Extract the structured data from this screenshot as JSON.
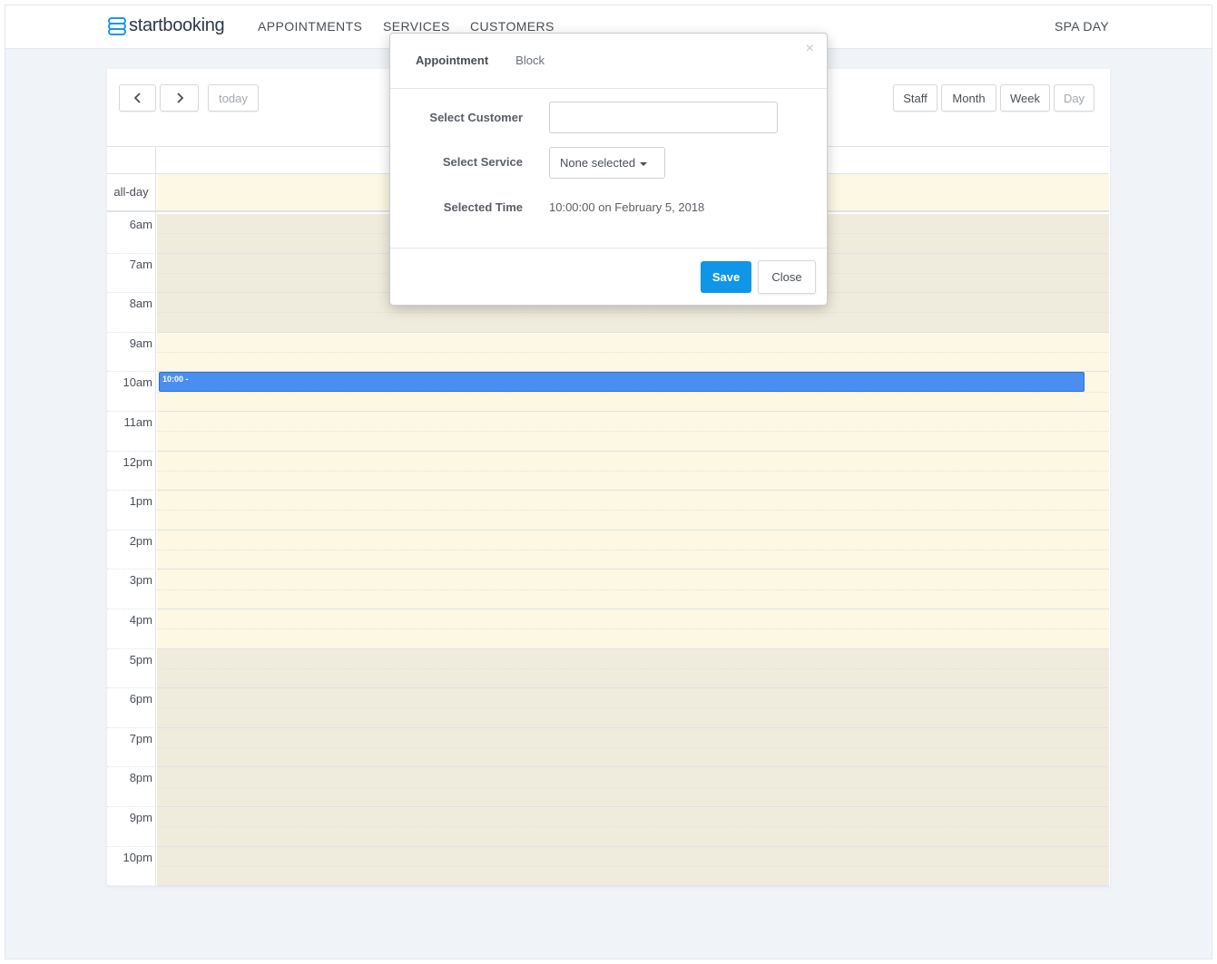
{
  "brand": {
    "name": "startbooking",
    "logo_icon": "startbooking-logo-icon",
    "accent": "#1a96e8"
  },
  "nav": {
    "items": [
      {
        "label": "APPOINTMENTS"
      },
      {
        "label": "SERVICES"
      },
      {
        "label": "CUSTOMERS"
      }
    ],
    "business_name": "SPA DAY"
  },
  "toolbar": {
    "prev_icon": "chevron-left-icon",
    "next_icon": "chevron-right-icon",
    "today_label": "today",
    "views": [
      {
        "label": "Staff",
        "active": false
      },
      {
        "label": "Month",
        "active": false
      },
      {
        "label": "Week",
        "active": false
      },
      {
        "label": "Day",
        "active": true
      }
    ]
  },
  "calendar": {
    "allday_label": "all-day",
    "hours": [
      {
        "label": "6am",
        "open": false
      },
      {
        "label": "7am",
        "open": false
      },
      {
        "label": "8am",
        "open": false
      },
      {
        "label": "9am",
        "open": true
      },
      {
        "label": "10am",
        "open": true
      },
      {
        "label": "11am",
        "open": true
      },
      {
        "label": "12pm",
        "open": true
      },
      {
        "label": "1pm",
        "open": true
      },
      {
        "label": "2pm",
        "open": true
      },
      {
        "label": "3pm",
        "open": true
      },
      {
        "label": "4pm",
        "open": true
      },
      {
        "label": "5pm",
        "open": false
      },
      {
        "label": "6pm",
        "open": false
      },
      {
        "label": "7pm",
        "open": false
      },
      {
        "label": "8pm",
        "open": false
      },
      {
        "label": "9pm",
        "open": false
      },
      {
        "label": "10pm",
        "open": false
      }
    ],
    "event": {
      "label": "10:00 -",
      "color": "#4a8ff0"
    },
    "colors": {
      "open": "#fcf8e3",
      "closed": "#f0ecdd"
    }
  },
  "modal": {
    "close_icon": "close-icon",
    "close_glyph": "×",
    "tabs": [
      {
        "label": "Appointment",
        "active": true
      },
      {
        "label": "Block",
        "active": false
      }
    ],
    "customer_label": "Select Customer",
    "customer_value": "",
    "service_label": "Select Service",
    "service_value": "None selected",
    "time_label": "Selected Time",
    "time_value": "10:00:00 on February 5, 2018",
    "save_label": "Save",
    "close_label": "Close",
    "save_color": "#0f96e6"
  }
}
